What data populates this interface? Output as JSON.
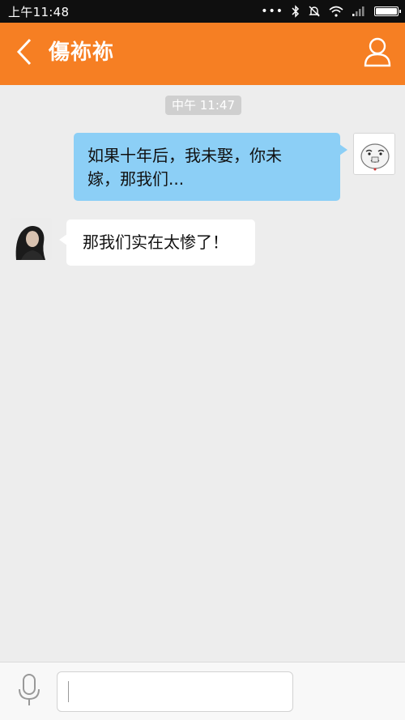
{
  "status_bar": {
    "time": "上午11:48",
    "icons": [
      "more-dots-icon",
      "bluetooth-icon",
      "bell-muted-icon",
      "wifi-icon",
      "signal-icon",
      "battery-icon"
    ],
    "dots": "•••"
  },
  "header": {
    "title": "傷袮袮",
    "icons": [
      "back-chevron-icon",
      "profile-icon"
    ]
  },
  "conversation": {
    "timestamp": "中午 11:47",
    "messages": [
      {
        "from": "me",
        "lines": [
          "如果十年后，我未娶，你未",
          "嫁，那我们..."
        ]
      },
      {
        "from": "other",
        "text": "那我们实在太惨了！"
      }
    ]
  },
  "input": {
    "value": "",
    "icons": [
      "microphone-icon"
    ]
  },
  "colors": {
    "brand": "#f67f23",
    "bubble_out": "#8ccff6",
    "bubble_in": "#ffffff",
    "background": "#ededed",
    "status_bar": "#0f0f0f"
  }
}
